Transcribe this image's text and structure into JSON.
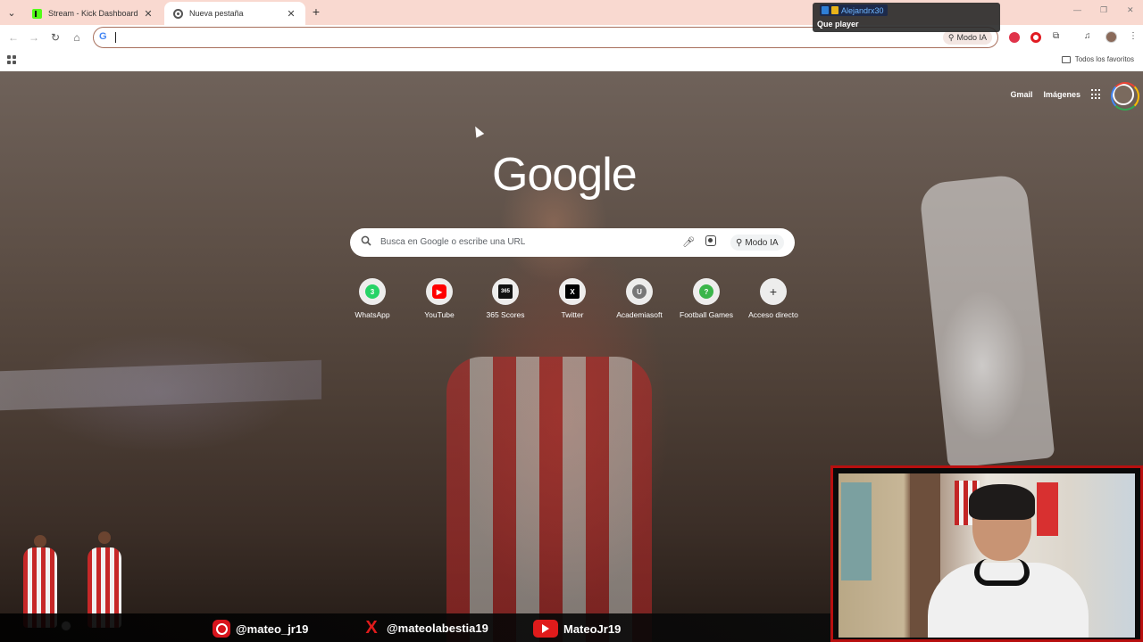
{
  "browser": {
    "tabs": [
      {
        "label": "Stream - Kick Dashboard",
        "active": false,
        "icon": "kick-icon"
      },
      {
        "label": "Nueva pestaña",
        "active": true,
        "icon": "chrome-icon"
      }
    ],
    "omnibox": {
      "value": "",
      "ai_mode_label": "Modo IA"
    },
    "bookmarks": {
      "all_favorites_label": "Todos los favoritos"
    }
  },
  "chat_popup": {
    "username": "Alejandrx30",
    "message": "Que player"
  },
  "ntp": {
    "top_links": {
      "gmail": "Gmail",
      "images": "Imágenes"
    },
    "logo": "Google",
    "search": {
      "placeholder": "Busca en Google o escribe una URL",
      "ai_mode_label": "Modo IA"
    },
    "shortcuts": [
      {
        "label": "WhatsApp",
        "icon": "whatsapp-icon",
        "color": "#25d366",
        "glyph": "3"
      },
      {
        "label": "YouTube",
        "icon": "youtube-icon",
        "color": "#ff0000",
        "glyph": "▶"
      },
      {
        "label": "365 Scores",
        "icon": "365scores-icon",
        "color": "#111111",
        "glyph": "365"
      },
      {
        "label": "Twitter",
        "icon": "x-icon",
        "color": "#000000",
        "glyph": "X"
      },
      {
        "label": "Academiasoft",
        "icon": "academiasoft-icon",
        "color": "#777777",
        "glyph": "U"
      },
      {
        "label": "Football Games",
        "icon": "question-icon",
        "color": "#3ab54a",
        "glyph": "?"
      },
      {
        "label": "Acceso directo",
        "icon": "plus-icon",
        "color": "#f5f5f5",
        "glyph": "+"
      }
    ]
  },
  "stream_overlay": {
    "socials": [
      {
        "icon": "instagram-icon",
        "handle": "@mateo_jr19"
      },
      {
        "icon": "x-icon",
        "handle": "@mateolabestia19"
      },
      {
        "icon": "youtube-icon",
        "handle": "MateoJr19"
      }
    ],
    "accent_color": "#d8141c"
  }
}
